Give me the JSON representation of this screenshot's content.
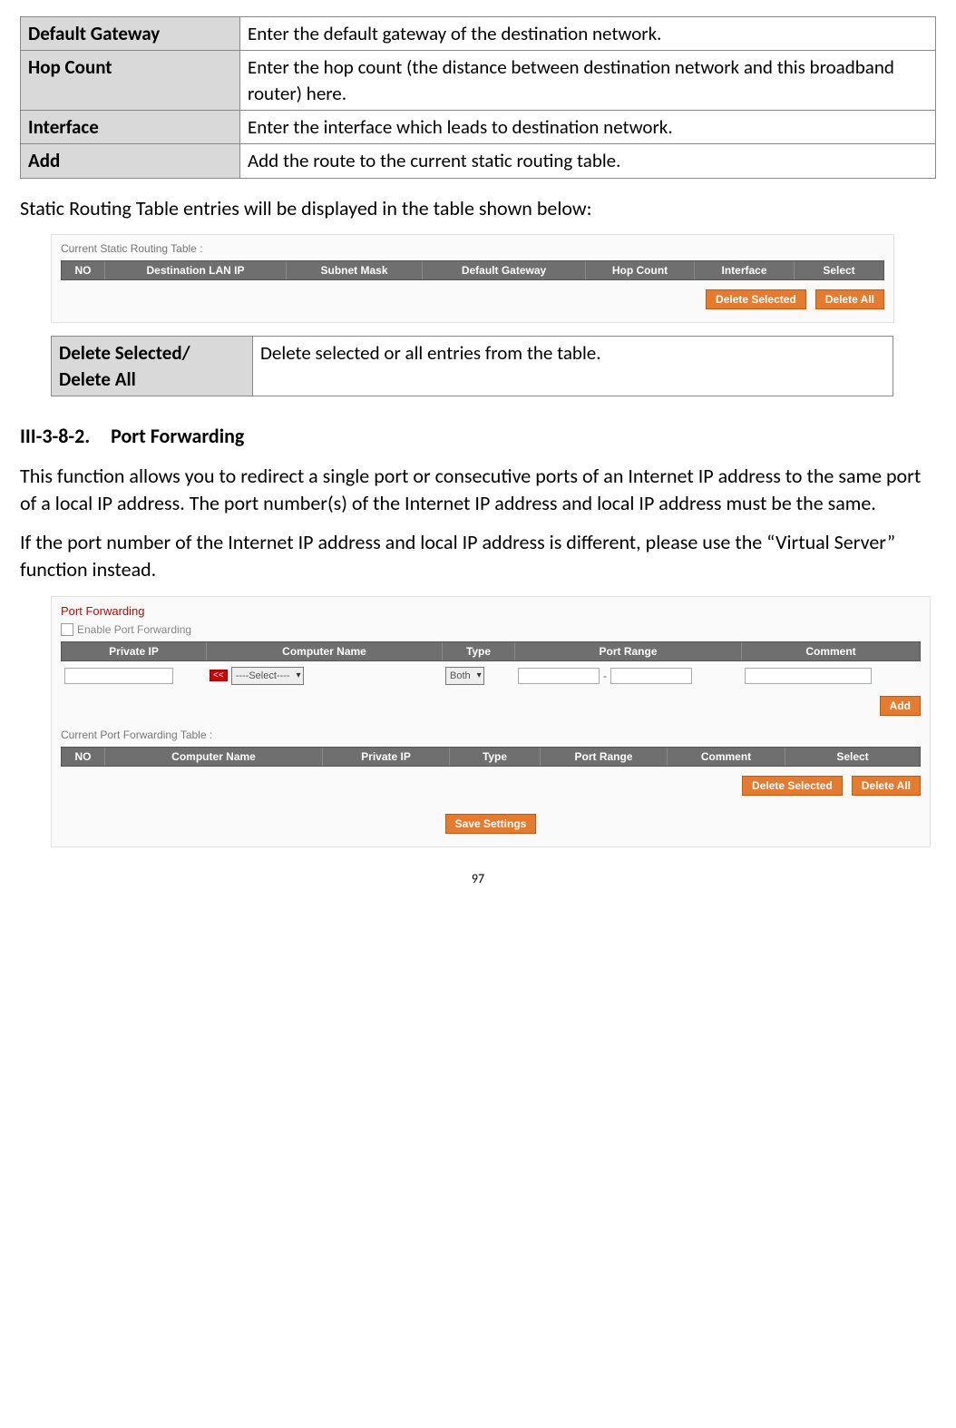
{
  "table1": {
    "rows": [
      {
        "label": "Default Gateway",
        "desc": "Enter the default gateway of the destination network."
      },
      {
        "label": "Hop Count",
        "desc": "Enter the hop count (the distance between destination network and this broadband router) here."
      },
      {
        "label": "Interface",
        "desc": "Enter the interface which leads to destination network."
      },
      {
        "label": "Add",
        "desc": "Add the route to the current static routing table."
      }
    ]
  },
  "para1": "Static Routing Table entries will be displayed in the table shown below:",
  "panel1": {
    "subtitle": "Current Static Routing Table :",
    "headers": [
      "NO",
      "Destination LAN IP",
      "Subnet Mask",
      "Default Gateway",
      "Hop Count",
      "Interface",
      "Select"
    ],
    "btn1": "Delete Selected",
    "btn2": "Delete All"
  },
  "table2": {
    "label": "Delete Selected/ Delete All",
    "desc": "Delete selected or all entries from the table."
  },
  "section": {
    "num": "III-3-8-2.",
    "title": "Port Forwarding"
  },
  "para2": "This function allows you to redirect a single port or consecutive ports of an Internet IP address to the same port of a local IP address. The port number(s) of the Internet IP address and local IP address must be the same.",
  "para3": "If the port number of the Internet IP address and local IP address is different, please use the “Virtual Server” function instead.",
  "panel2": {
    "title": "Port Forwarding",
    "enable": "Enable  Port Forwarding",
    "headers1": [
      "Private IP",
      "Computer Name",
      "Type",
      "Port Range",
      "Comment"
    ],
    "sel_computer": "----Select----",
    "sel_type": "Both",
    "chip": "<<",
    "dash": "-",
    "btn_add": "Add",
    "subtitle": "Current Port Forwarding Table :",
    "headers2": [
      "NO",
      "Computer Name",
      "Private IP",
      "Type",
      "Port Range",
      "Comment",
      "Select"
    ],
    "btn_del1": "Delete Selected",
    "btn_del2": "Delete All",
    "btn_save": "Save Settings"
  },
  "page": "97"
}
